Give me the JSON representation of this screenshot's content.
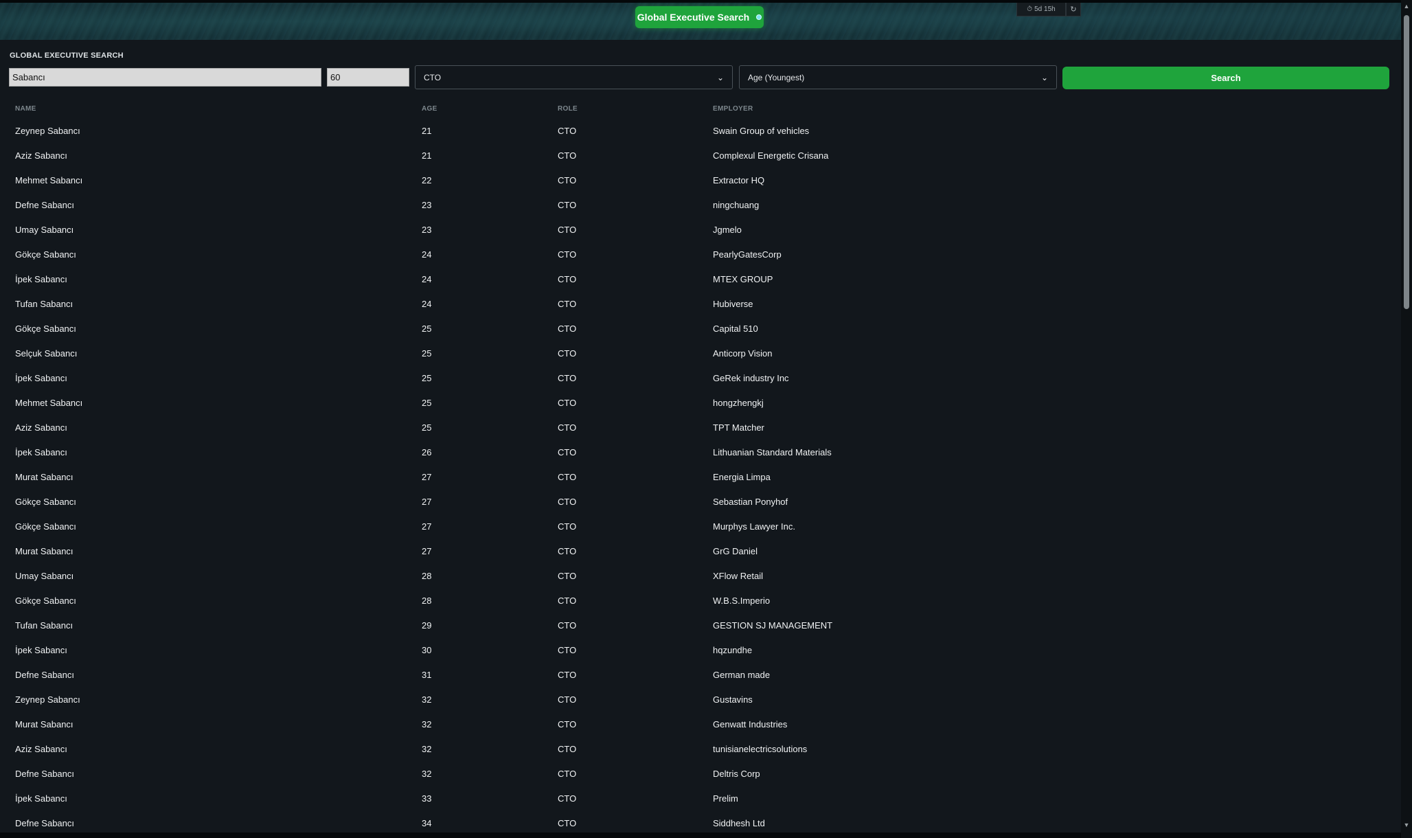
{
  "header": {
    "title": "Global Executive Search",
    "timer": "5d 15h",
    "timer_icon": "clock-icon",
    "refresh_icon": "refresh-icon"
  },
  "search": {
    "section_title": "GLOBAL EXECUTIVE SEARCH",
    "name_value": "Sabancı",
    "age_value": "60",
    "role_selected": "CTO",
    "sort_selected": "Age (Youngest)",
    "button_label": "Search"
  },
  "table": {
    "headers": {
      "name": "NAME",
      "age": "AGE",
      "role": "ROLE",
      "employer": "EMPLOYER"
    },
    "rows": [
      {
        "name": "Zeynep Sabancı",
        "age": "21",
        "role": "CTO",
        "employer": "Swain Group of vehicles"
      },
      {
        "name": "Aziz Sabancı",
        "age": "21",
        "role": "CTO",
        "employer": "Complexul Energetic Crisana"
      },
      {
        "name": "Mehmet Sabancı",
        "age": "22",
        "role": "CTO",
        "employer": "Extractor HQ"
      },
      {
        "name": "Defne Sabancı",
        "age": "23",
        "role": "CTO",
        "employer": "ningchuang"
      },
      {
        "name": "Umay Sabancı",
        "age": "23",
        "role": "CTO",
        "employer": "Jgmelo"
      },
      {
        "name": "Gökçe Sabancı",
        "age": "24",
        "role": "CTO",
        "employer": "PearlyGatesCorp"
      },
      {
        "name": "İpek Sabancı",
        "age": "24",
        "role": "CTO",
        "employer": "MTEX GROUP"
      },
      {
        "name": "Tufan Sabancı",
        "age": "24",
        "role": "CTO",
        "employer": "Hubiverse"
      },
      {
        "name": "Gökçe Sabancı",
        "age": "25",
        "role": "CTO",
        "employer": "Capital 510"
      },
      {
        "name": "Selçuk Sabancı",
        "age": "25",
        "role": "CTO",
        "employer": "Anticorp Vision"
      },
      {
        "name": "İpek Sabancı",
        "age": "25",
        "role": "CTO",
        "employer": "GeRek industry Inc"
      },
      {
        "name": "Mehmet Sabancı",
        "age": "25",
        "role": "CTO",
        "employer": "hongzhengkj"
      },
      {
        "name": "Aziz Sabancı",
        "age": "25",
        "role": "CTO",
        "employer": "TPT Matcher"
      },
      {
        "name": "İpek Sabancı",
        "age": "26",
        "role": "CTO",
        "employer": "Lithuanian Standard Materials"
      },
      {
        "name": "Murat Sabancı",
        "age": "27",
        "role": "CTO",
        "employer": "Energia Limpa"
      },
      {
        "name": "Gökçe Sabancı",
        "age": "27",
        "role": "CTO",
        "employer": "Sebastian Ponyhof"
      },
      {
        "name": "Gökçe Sabancı",
        "age": "27",
        "role": "CTO",
        "employer": "Murphys Lawyer Inc."
      },
      {
        "name": "Murat Sabancı",
        "age": "27",
        "role": "CTO",
        "employer": "GrG Daniel"
      },
      {
        "name": "Umay Sabancı",
        "age": "28",
        "role": "CTO",
        "employer": "XFlow Retail"
      },
      {
        "name": "Gökçe Sabancı",
        "age": "28",
        "role": "CTO",
        "employer": "W.B.S.Imperio"
      },
      {
        "name": "Tufan Sabancı",
        "age": "29",
        "role": "CTO",
        "employer": "GESTION SJ MANAGEMENT"
      },
      {
        "name": "İpek Sabancı",
        "age": "30",
        "role": "CTO",
        "employer": "hqzundhe"
      },
      {
        "name": "Defne Sabancı",
        "age": "31",
        "role": "CTO",
        "employer": "German made"
      },
      {
        "name": "Zeynep Sabancı",
        "age": "32",
        "role": "CTO",
        "employer": "Gustavins"
      },
      {
        "name": "Murat Sabancı",
        "age": "32",
        "role": "CTO",
        "employer": "Genwatt Industries"
      },
      {
        "name": "Aziz Sabancı",
        "age": "32",
        "role": "CTO",
        "employer": "tunisianelectricsolutions"
      },
      {
        "name": "Defne Sabancı",
        "age": "32",
        "role": "CTO",
        "employer": "Deltris Corp"
      },
      {
        "name": "İpek Sabancı",
        "age": "33",
        "role": "CTO",
        "employer": "Prelim"
      },
      {
        "name": "Defne Sabancı",
        "age": "34",
        "role": "CTO",
        "employer": "Siddhesh Ltd"
      }
    ]
  },
  "colors": {
    "accent": "#1fa43c",
    "background": "#12171c",
    "header_bg": "#163238"
  }
}
